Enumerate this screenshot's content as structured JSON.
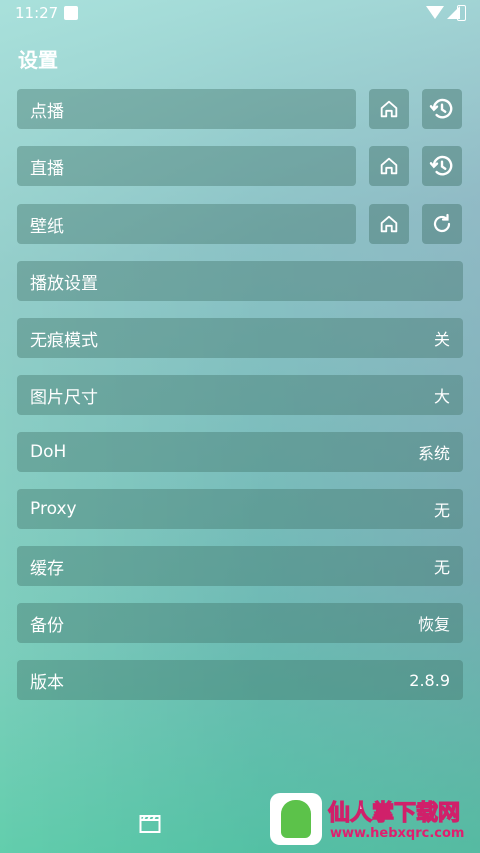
{
  "status_bar": {
    "time": "11:27"
  },
  "page": {
    "title": "设置"
  },
  "rows": [
    {
      "label": "点播"
    },
    {
      "label": "直播"
    },
    {
      "label": "壁纸"
    },
    {
      "label": "播放设置"
    },
    {
      "label": "无痕模式",
      "value": "关"
    },
    {
      "label": "图片尺寸",
      "value": "大"
    },
    {
      "label": "DoH",
      "value": "系统"
    },
    {
      "label": "Proxy",
      "value": "无"
    },
    {
      "label": "缓存",
      "value": "无"
    },
    {
      "label": "备份",
      "value": "恢复"
    },
    {
      "label": "版本",
      "value": "2.8.9"
    }
  ],
  "icons": {
    "home": "home-icon",
    "history": "history-icon",
    "refresh": "refresh-icon",
    "bottom_nav": "clapperboard-icon"
  },
  "watermark": {
    "text": "仙人掌下载网",
    "url": "www.hebxqrc.com"
  }
}
